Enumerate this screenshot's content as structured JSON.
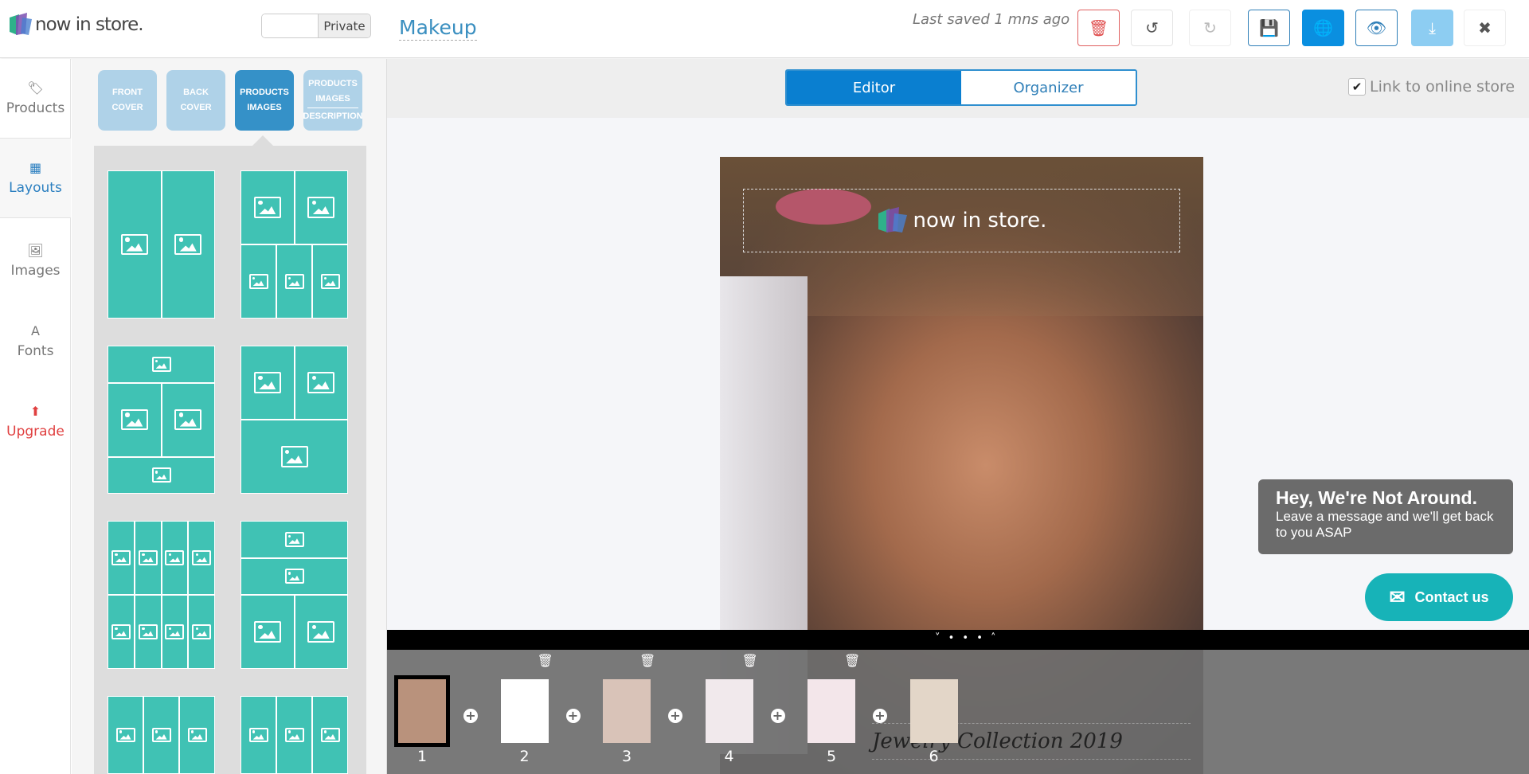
{
  "header": {
    "logo_text": "now in store.",
    "privacy_label": "Private",
    "document_title": "Makeup",
    "last_saved": "Last saved 1 mns ago",
    "buttons": [
      {
        "name": "delete-button",
        "icon": "trash-icon",
        "glyph": "🗑",
        "color": "#e05050",
        "border": "#e06060",
        "bg": "#ffffff"
      },
      {
        "name": "undo-button",
        "icon": "undo-icon",
        "glyph": "↺",
        "color": "#555555",
        "border": "#e5e5e5",
        "bg": "#ffffff"
      },
      {
        "name": "redo-button",
        "icon": "redo-icon",
        "glyph": "↻",
        "color": "#bbbbbb",
        "border": "#eeeeee",
        "bg": "#ffffff"
      },
      {
        "name": "save-button",
        "icon": "floppy-disk-icon",
        "glyph": "💾",
        "color": "#2f7fb8",
        "border": "#2f7fb8",
        "bg": "#ffffff"
      },
      {
        "name": "publish-button",
        "icon": "globe-icon",
        "glyph": "🌐",
        "color": "#ffffff",
        "border": "#0a8fe0",
        "bg": "#0a8fe0"
      },
      {
        "name": "preview-button",
        "icon": "eye-icon",
        "glyph": "👁",
        "color": "#2f7fb8",
        "border": "#2f7fb8",
        "bg": "#ffffff"
      },
      {
        "name": "download-button",
        "icon": "download-icon",
        "glyph": "⤓",
        "color": "#ffffff",
        "border": "#8dcdf2",
        "bg": "#8dcdf2"
      },
      {
        "name": "close-button",
        "icon": "close-icon",
        "glyph": "✖",
        "color": "#555555",
        "border": "#eeeeee",
        "bg": "#ffffff"
      }
    ]
  },
  "sidebar": {
    "items": [
      {
        "label": "Products",
        "icon": "tag-icon",
        "glyph": "🏷"
      },
      {
        "label": "Layouts",
        "icon": "grid-icon",
        "glyph": "▦",
        "active": true
      },
      {
        "label": "Images",
        "icon": "image-icon",
        "glyph": "🖼"
      },
      {
        "label": "Fonts",
        "icon": "font-icon",
        "glyph": "A"
      },
      {
        "label": "Upgrade",
        "icon": "arrow-up-icon",
        "glyph": "⬆",
        "color": "#e04040"
      }
    ]
  },
  "panel": {
    "tabs": [
      {
        "lines": [
          "FRONT",
          "COVER"
        ]
      },
      {
        "lines": [
          "BACK",
          "COVER"
        ]
      },
      {
        "lines": [
          "PRODUCTS",
          "IMAGES"
        ],
        "active": true
      },
      {
        "lines": [
          "PRODUCTS",
          "IMAGES"
        ],
        "extra": "DESCRIPTION"
      }
    ],
    "layout_color": "#40c2b4"
  },
  "editor": {
    "tabs": [
      {
        "label": "Editor",
        "active": true
      },
      {
        "label": "Organizer"
      }
    ],
    "link_store_label": "Link to online store",
    "link_store_checked": true,
    "page_logo_text": "now in store."
  },
  "pages": {
    "toggle": "˅ • • • ˄",
    "thumbs": [
      {
        "num": "1",
        "selected": true,
        "bg": "#b9927c"
      },
      {
        "num": "2",
        "bg": "#ffffff"
      },
      {
        "num": "3",
        "bg": "#d9c3b8"
      },
      {
        "num": "4",
        "bg": "#f1e9ec"
      },
      {
        "num": "5",
        "bg": "#f3e6ea"
      },
      {
        "num": "6",
        "bg": "#e3d6c8"
      }
    ],
    "overlay_text": "Jewelry Collection 2019"
  },
  "chat": {
    "title": "Hey, We're Not Around.",
    "message": "Leave a message and we'll get back to you ASAP",
    "button": "Contact us",
    "color": "#17b3b8"
  }
}
